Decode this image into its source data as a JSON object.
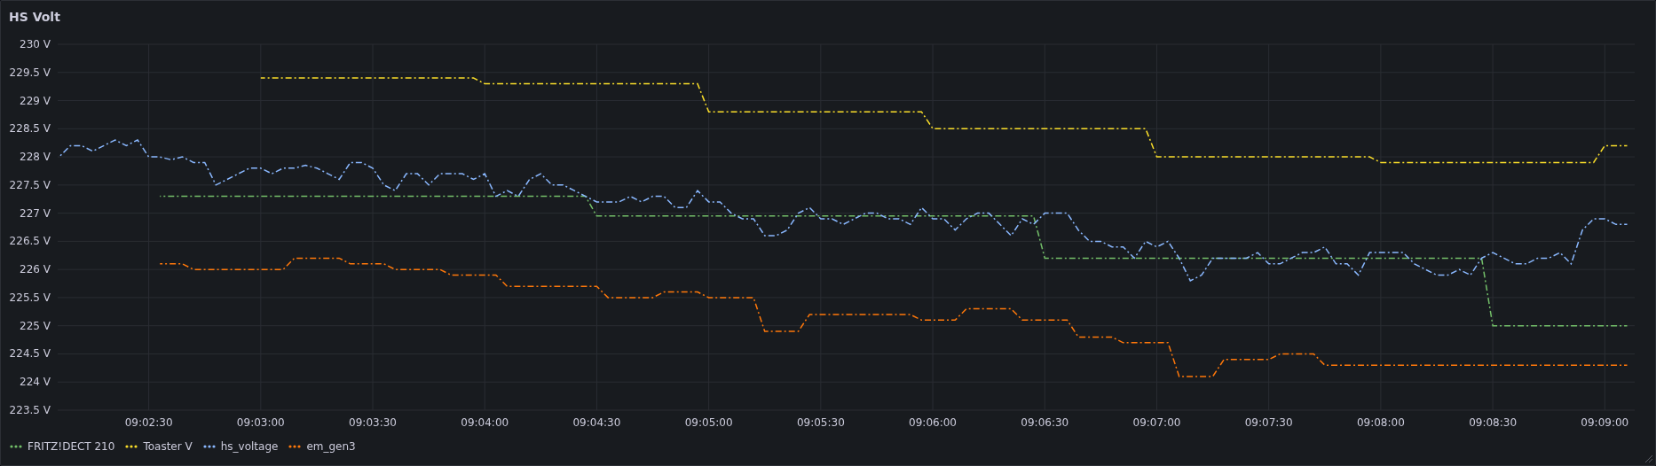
{
  "panel": {
    "title": "HS Volt",
    "chart_data": {
      "type": "line",
      "grid": true,
      "ylim": [
        223.5,
        230
      ],
      "yticks": [
        {
          "value": 230,
          "label": "230 V"
        },
        {
          "value": 229.5,
          "label": "229.5 V"
        },
        {
          "value": 229,
          "label": "229 V"
        },
        {
          "value": 228.5,
          "label": "228.5 V"
        },
        {
          "value": 228,
          "label": "228 V"
        },
        {
          "value": 227.5,
          "label": "227.5 V"
        },
        {
          "value": 227,
          "label": "227 V"
        },
        {
          "value": 226.5,
          "label": "226.5 V"
        },
        {
          "value": 226,
          "label": "226 V"
        },
        {
          "value": 225.5,
          "label": "225.5 V"
        },
        {
          "value": 225,
          "label": "225 V"
        },
        {
          "value": 224.5,
          "label": "224.5 V"
        },
        {
          "value": 224,
          "label": "224 V"
        },
        {
          "value": 223.5,
          "label": "223.5 V"
        }
      ],
      "categories": [
        null,
        null,
        null,
        null,
        null,
        null,
        null,
        null,
        "09:02:30",
        null,
        null,
        null,
        null,
        null,
        null,
        null,
        null,
        null,
        "09:03:00",
        null,
        null,
        null,
        null,
        null,
        null,
        null,
        null,
        null,
        "09:03:30",
        null,
        null,
        null,
        null,
        null,
        null,
        null,
        null,
        null,
        "09:04:00",
        null,
        null,
        null,
        null,
        null,
        null,
        null,
        null,
        null,
        "09:04:30",
        null,
        null,
        null,
        null,
        null,
        null,
        null,
        null,
        null,
        "09:05:00",
        null,
        null,
        null,
        null,
        null,
        null,
        null,
        null,
        null,
        "09:05:30",
        null,
        null,
        null,
        null,
        null,
        null,
        null,
        null,
        null,
        "09:06:00",
        null,
        null,
        null,
        null,
        null,
        null,
        null,
        null,
        null,
        "09:06:30",
        null,
        null,
        null,
        null,
        null,
        null,
        null,
        null,
        null,
        "09:07:00",
        null,
        null,
        null,
        null,
        null,
        null,
        null,
        null,
        null,
        "09:07:30",
        null,
        null,
        null,
        null,
        null,
        null,
        null,
        null,
        null,
        "09:08:00",
        null,
        null,
        null,
        null,
        null,
        null,
        null,
        null,
        null,
        "09:08:30",
        null,
        null,
        null,
        null,
        null,
        null,
        null,
        null,
        null,
        "09:09:00",
        null,
        null
      ],
      "series": [
        {
          "name": "FRITZ!DECT 210",
          "color": "#73bf69",
          "line_style": "dashdot",
          "values": [
            null,
            null,
            null,
            null,
            null,
            null,
            null,
            null,
            null,
            227.3,
            227.3,
            227.3,
            227.3,
            227.3,
            227.3,
            227.3,
            227.3,
            227.3,
            227.3,
            227.3,
            227.3,
            227.3,
            227.3,
            227.3,
            227.3,
            227.3,
            227.3,
            227.3,
            227.3,
            227.3,
            227.3,
            227.3,
            227.3,
            227.3,
            227.3,
            227.3,
            227.3,
            227.3,
            227.3,
            227.3,
            227.3,
            227.3,
            227.3,
            227.3,
            227.3,
            227.3,
            227.3,
            227.3,
            226.95,
            226.95,
            226.95,
            226.95,
            226.95,
            226.95,
            226.95,
            226.95,
            226.95,
            226.95,
            226.95,
            226.95,
            226.95,
            226.95,
            226.95,
            226.95,
            226.95,
            226.95,
            226.95,
            226.95,
            226.95,
            226.95,
            226.95,
            226.95,
            226.95,
            226.95,
            226.95,
            226.95,
            226.95,
            226.95,
            226.95,
            226.95,
            226.95,
            226.95,
            226.95,
            226.95,
            226.95,
            226.95,
            226.95,
            226.95,
            226.2,
            226.2,
            226.2,
            226.2,
            226.2,
            226.2,
            226.2,
            226.2,
            226.2,
            226.2,
            226.2,
            226.2,
            226.2,
            226.2,
            226.2,
            226.2,
            226.2,
            226.2,
            226.2,
            226.2,
            226.2,
            226.2,
            226.2,
            226.2,
            226.2,
            226.2,
            226.2,
            226.2,
            226.2,
            226.2,
            226.2,
            226.2,
            226.2,
            226.2,
            226.2,
            226.2,
            226.2,
            226.2,
            226.2,
            226.2,
            225.0,
            225.0,
            225.0,
            225.0,
            225.0,
            225.0,
            225.0,
            225.0,
            225.0,
            225.0,
            225.0,
            225.0,
            225.0
          ]
        },
        {
          "name": "Toaster V",
          "color": "#fade2a",
          "line_style": "dashdot",
          "values": [
            null,
            null,
            null,
            null,
            null,
            null,
            null,
            null,
            null,
            null,
            null,
            null,
            null,
            null,
            null,
            null,
            null,
            null,
            229.4,
            229.4,
            229.4,
            229.4,
            229.4,
            229.4,
            229.4,
            229.4,
            229.4,
            229.4,
            229.4,
            229.4,
            229.4,
            229.4,
            229.4,
            229.4,
            229.4,
            229.4,
            229.4,
            229.4,
            229.3,
            229.3,
            229.3,
            229.3,
            229.3,
            229.3,
            229.3,
            229.3,
            229.3,
            229.3,
            229.3,
            229.3,
            229.3,
            229.3,
            229.3,
            229.3,
            229.3,
            229.3,
            229.3,
            229.3,
            228.8,
            228.8,
            228.8,
            228.8,
            228.8,
            228.8,
            228.8,
            228.8,
            228.8,
            228.8,
            228.8,
            228.8,
            228.8,
            228.8,
            228.8,
            228.8,
            228.8,
            228.8,
            228.8,
            228.8,
            228.5,
            228.5,
            228.5,
            228.5,
            228.5,
            228.5,
            228.5,
            228.5,
            228.5,
            228.5,
            228.5,
            228.5,
            228.5,
            228.5,
            228.5,
            228.5,
            228.5,
            228.5,
            228.5,
            228.5,
            228.0,
            228.0,
            228.0,
            228.0,
            228.0,
            228.0,
            228.0,
            228.0,
            228.0,
            228.0,
            228.0,
            228.0,
            228.0,
            228.0,
            228.0,
            228.0,
            228.0,
            228.0,
            228.0,
            228.0,
            227.9,
            227.9,
            227.9,
            227.9,
            227.9,
            227.9,
            227.9,
            227.9,
            227.9,
            227.9,
            227.9,
            227.9,
            227.9,
            227.9,
            227.9,
            227.9,
            227.9,
            227.9,
            227.9,
            227.9,
            228.2,
            228.2,
            228.2
          ]
        },
        {
          "name": "hs_voltage",
          "color": "#8ab8ff",
          "line_style": "dashdot",
          "values": [
            228.0,
            228.2,
            228.2,
            228.1,
            228.2,
            228.3,
            228.2,
            228.3,
            228.0,
            228.0,
            227.95,
            228.0,
            227.9,
            227.9,
            227.5,
            227.6,
            227.7,
            227.8,
            227.8,
            227.7,
            227.8,
            227.8,
            227.85,
            227.8,
            227.7,
            227.6,
            227.9,
            227.9,
            227.8,
            227.5,
            227.4,
            227.7,
            227.7,
            227.5,
            227.7,
            227.7,
            227.7,
            227.6,
            227.7,
            227.3,
            227.4,
            227.3,
            227.6,
            227.7,
            227.5,
            227.5,
            227.4,
            227.3,
            227.2,
            227.2,
            227.2,
            227.3,
            227.2,
            227.3,
            227.3,
            227.1,
            227.1,
            227.4,
            227.2,
            227.2,
            227.0,
            226.9,
            226.9,
            226.6,
            226.6,
            226.7,
            227.0,
            227.1,
            226.9,
            226.9,
            226.8,
            226.9,
            227.0,
            227.0,
            226.9,
            226.9,
            226.8,
            227.1,
            226.9,
            226.9,
            226.7,
            226.9,
            227.0,
            227.0,
            226.8,
            226.6,
            226.9,
            226.8,
            227.0,
            227.0,
            227.0,
            226.7,
            226.5,
            226.5,
            226.4,
            226.4,
            226.2,
            226.5,
            226.4,
            226.5,
            226.2,
            225.8,
            225.9,
            226.2,
            226.2,
            226.2,
            226.2,
            226.3,
            226.1,
            226.1,
            226.2,
            226.3,
            226.3,
            226.4,
            226.1,
            226.1,
            225.9,
            226.3,
            226.3,
            226.3,
            226.3,
            226.1,
            226.0,
            225.9,
            225.9,
            226.0,
            225.9,
            226.2,
            226.3,
            226.2,
            226.1,
            226.1,
            226.2,
            226.2,
            226.3,
            226.1,
            226.7,
            226.9,
            226.9,
            226.8,
            226.8
          ]
        },
        {
          "name": "em_gen3",
          "color": "#ff780a",
          "line_style": "dashdot",
          "values": [
            null,
            null,
            null,
            null,
            null,
            null,
            null,
            null,
            null,
            226.1,
            226.1,
            226.1,
            226.0,
            226.0,
            226.0,
            226.0,
            226.0,
            226.0,
            226.0,
            226.0,
            226.0,
            226.2,
            226.2,
            226.2,
            226.2,
            226.2,
            226.1,
            226.1,
            226.1,
            226.1,
            226.0,
            226.0,
            226.0,
            226.0,
            226.0,
            225.9,
            225.9,
            225.9,
            225.9,
            225.9,
            225.7,
            225.7,
            225.7,
            225.7,
            225.7,
            225.7,
            225.7,
            225.7,
            225.7,
            225.5,
            225.5,
            225.5,
            225.5,
            225.5,
            225.6,
            225.6,
            225.6,
            225.6,
            225.5,
            225.5,
            225.5,
            225.5,
            225.5,
            224.9,
            224.9,
            224.9,
            224.9,
            225.2,
            225.2,
            225.2,
            225.2,
            225.2,
            225.2,
            225.2,
            225.2,
            225.2,
            225.2,
            225.1,
            225.1,
            225.1,
            225.1,
            225.3,
            225.3,
            225.3,
            225.3,
            225.3,
            225.1,
            225.1,
            225.1,
            225.1,
            225.1,
            224.8,
            224.8,
            224.8,
            224.8,
            224.7,
            224.7,
            224.7,
            224.7,
            224.7,
            224.1,
            224.1,
            224.1,
            224.1,
            224.4,
            224.4,
            224.4,
            224.4,
            224.4,
            224.5,
            224.5,
            224.5,
            224.5,
            224.3,
            224.3,
            224.3,
            224.3,
            224.3,
            224.3,
            224.3,
            224.3,
            224.3,
            224.3,
            224.3,
            224.3,
            224.3,
            224.3,
            224.3,
            224.3,
            224.3,
            224.3,
            224.3,
            224.3,
            224.3,
            224.3,
            224.3,
            224.3,
            224.3,
            224.3,
            224.3,
            224.3
          ]
        }
      ]
    }
  }
}
